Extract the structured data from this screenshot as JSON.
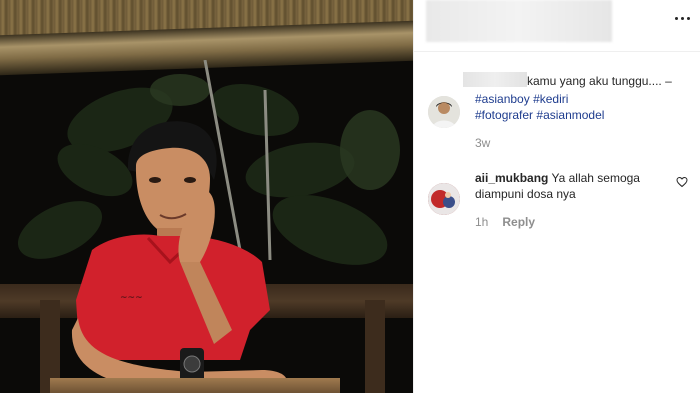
{
  "post": {
    "more_icon": "ellipsis-icon"
  },
  "caption": {
    "text": "kamu yang aku tunggu....",
    "trailing_glyph": "–",
    "hashtags_line1": [
      "#asianboy",
      "#kediri"
    ],
    "hashtags_line2": [
      "#fotografer",
      "#asianmodel"
    ],
    "time": "3w"
  },
  "comments": [
    {
      "username": "aii_mukbang",
      "text": "Ya allah semoga diampuni dosa nya",
      "time": "1h",
      "reply_label": "Reply",
      "like_icon": "heart-icon"
    }
  ],
  "colors": {
    "hashtag": "#1e3c8e",
    "meta": "#8e8e8e",
    "text": "#262626"
  }
}
